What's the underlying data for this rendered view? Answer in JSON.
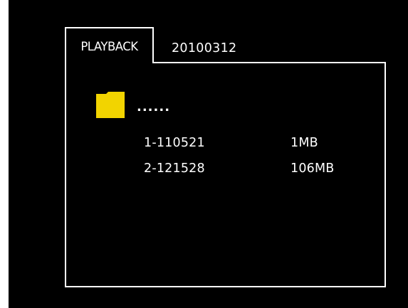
{
  "header": {
    "tab_label": "PLAYBACK",
    "date": "20100312"
  },
  "browser": {
    "parent_label": "......",
    "files": [
      {
        "name": "1-110521",
        "size": "1MB"
      },
      {
        "name": "2-121528",
        "size": "106MB"
      }
    ]
  },
  "colors": {
    "background": "#000000",
    "foreground": "#ffffff",
    "folder": "#f2d400"
  }
}
